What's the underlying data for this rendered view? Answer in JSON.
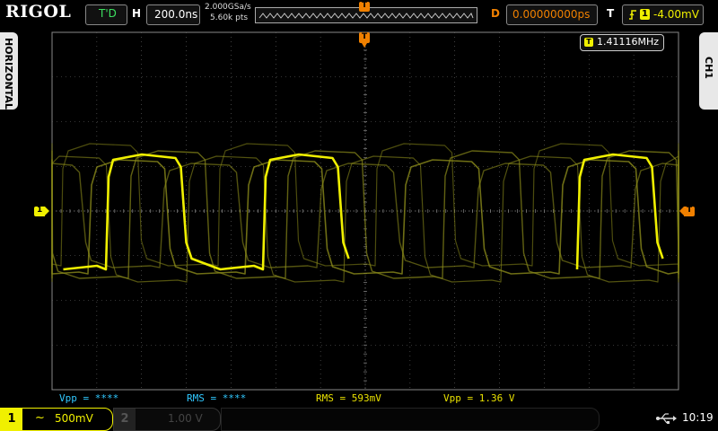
{
  "topbar": {
    "brand": "RIGOL",
    "run_status": "T'D",
    "timebase_label": "H",
    "timebase_value": "200.0ns",
    "sample_rate": "2.000GSa/s",
    "memory_depth": "5.60k pts",
    "trigger_marker": "T",
    "delay_label": "D",
    "delay_value": "0.00000000ps",
    "trigger_label": "T",
    "trigger_source": "1",
    "trigger_level": "-4.00mV"
  },
  "side": {
    "left_tab": "HORIZONTAL",
    "right_tab": "CH1"
  },
  "screen": {
    "freq_badge_icon": "T",
    "frequency": "1.41116MHz",
    "ch1_marker": "1",
    "trig_level_marker": "T"
  },
  "measurements": [
    {
      "label": "Vpp = ****",
      "color": "#30c8ff"
    },
    {
      "label": "RMS = ****",
      "color": "#30c8ff"
    },
    {
      "label": "RMS = 593mV",
      "color": "#e8e000"
    },
    {
      "label": "Vpp = 1.36 V",
      "color": "#e8e000"
    }
  ],
  "bottombar": {
    "ch1_number": "1",
    "ch1_coupling": "~",
    "ch1_scale": "500mV",
    "ch2_number": "2",
    "ch2_scale": "1.00 V",
    "usb_icon": "usb-icon",
    "time": "10:19"
  },
  "colors": {
    "ch1": "#f0f000",
    "accent_orange": "#f08000",
    "grid": "#6a6a6a",
    "measure_cyan": "#30c8ff"
  }
}
